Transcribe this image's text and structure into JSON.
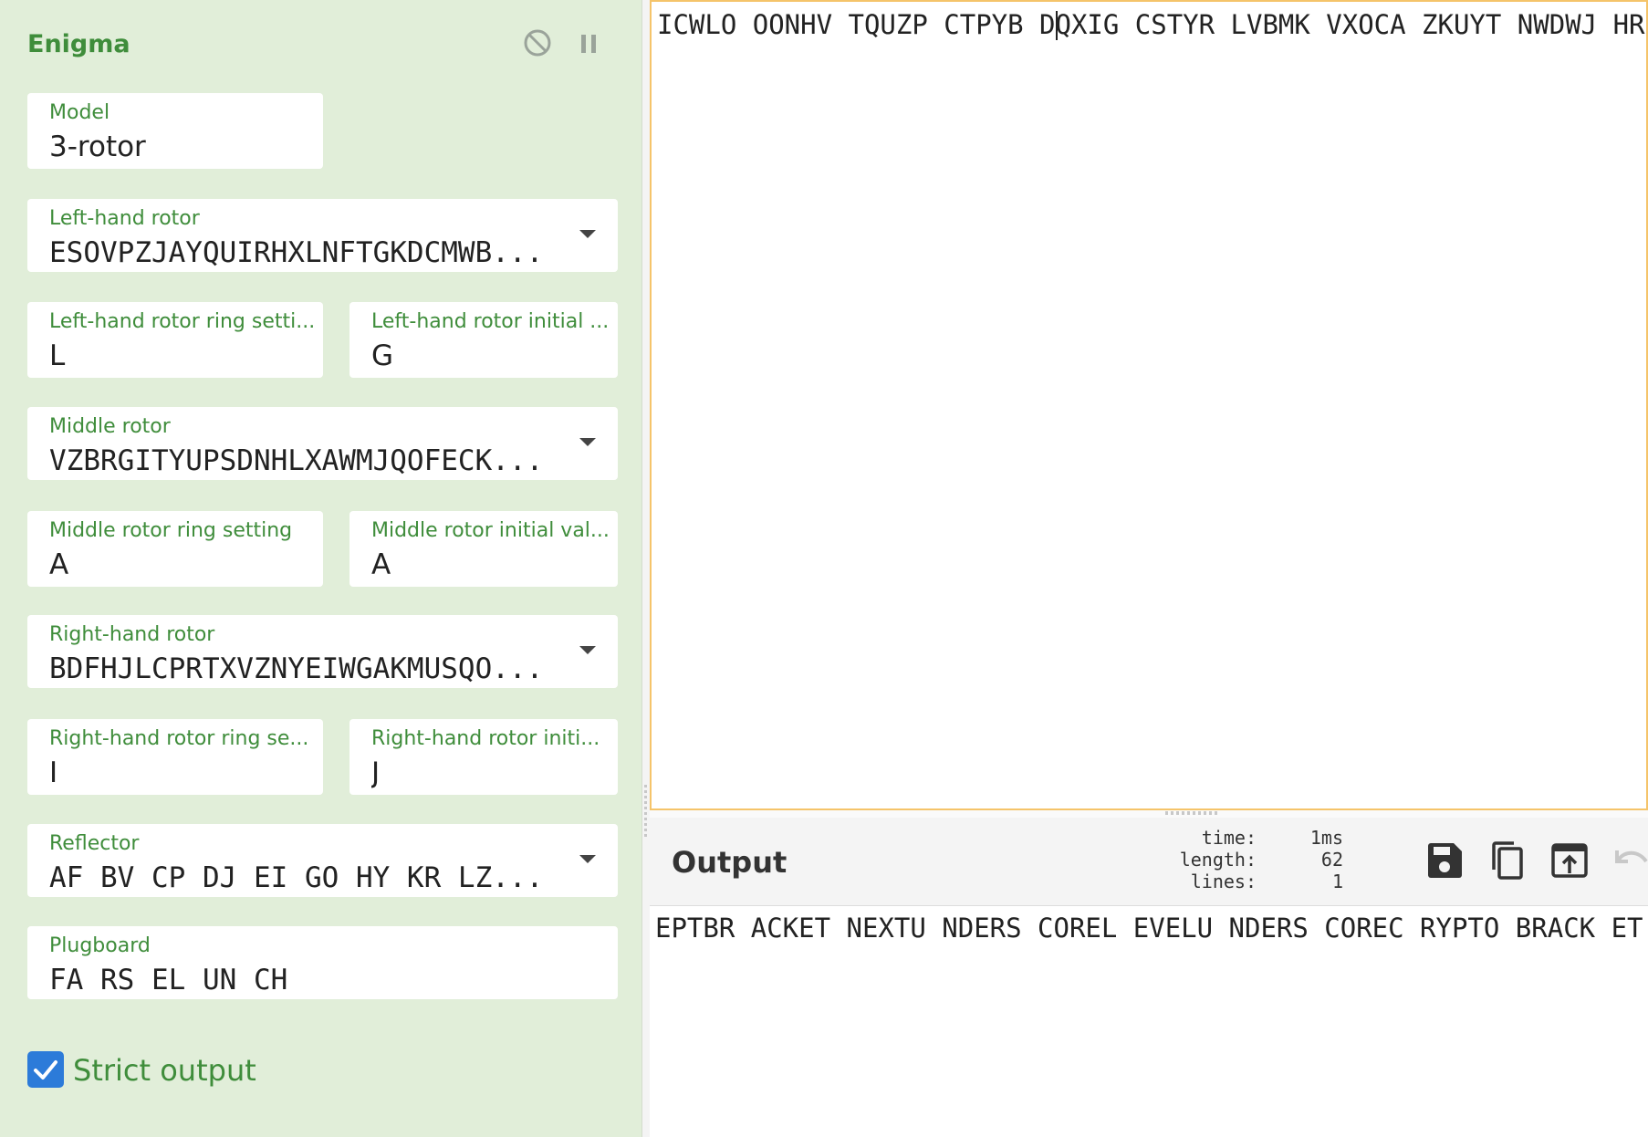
{
  "operation": {
    "title": "Enigma",
    "disable_icon": "disable-icon",
    "pause_icon": "pause-icon"
  },
  "fields": {
    "model": {
      "label": "Model",
      "value": "3-rotor"
    },
    "left_rotor": {
      "label": "Left-hand rotor",
      "value": "ESOVPZJAYQUIRHXLNFTGKDCMWB..."
    },
    "left_ring": {
      "label": "Left-hand rotor ring setti...",
      "value": "L"
    },
    "left_initial": {
      "label": "Left-hand rotor initial ...",
      "value": "G"
    },
    "middle_rotor": {
      "label": "Middle rotor",
      "value": "VZBRGITYUPSDNHLXAWMJQOFECK..."
    },
    "middle_ring": {
      "label": "Middle rotor ring setting",
      "value": "A"
    },
    "middle_initial": {
      "label": "Middle rotor initial val...",
      "value": "A"
    },
    "right_rotor": {
      "label": "Right-hand rotor",
      "value": "BDFHJLCPRTXVZNYEIWGAKMUSQO..."
    },
    "right_ring": {
      "label": "Right-hand rotor ring se...",
      "value": "I"
    },
    "right_initial": {
      "label": "Right-hand rotor initi...",
      "value": "J"
    },
    "reflector": {
      "label": "Reflector",
      "value": "AF BV CP DJ EI GO HY KR LZ..."
    },
    "plugboard": {
      "label": "Plugboard",
      "value": "FA RS EL UN CH"
    }
  },
  "strict_output": {
    "label": "Strict output",
    "checked": true
  },
  "input": {
    "text": "ICWLO OONHV TQUZP CTPYB DQXIG CSTYR LVBMK VXOCA ZKUYT NWDWJ HR"
  },
  "output": {
    "title": "Output",
    "stats": [
      {
        "key": "time:",
        "value": "1ms"
      },
      {
        "key": "length:",
        "value": "62"
      },
      {
        "key": "lines:",
        "value": "1"
      }
    ],
    "text": "EPTBR ACKET NEXTU NDERS COREL EVELU NDERS COREC RYPTO BRACK ET",
    "buttons": [
      "save-icon",
      "copy-icon",
      "replace-input-icon",
      "undo-icon"
    ]
  },
  "colors": {
    "panel_bg": "#e1eed9",
    "accent_green": "#3f8d3b",
    "checkbox_blue": "#2c7bd9",
    "input_border": "#f5c46a"
  }
}
